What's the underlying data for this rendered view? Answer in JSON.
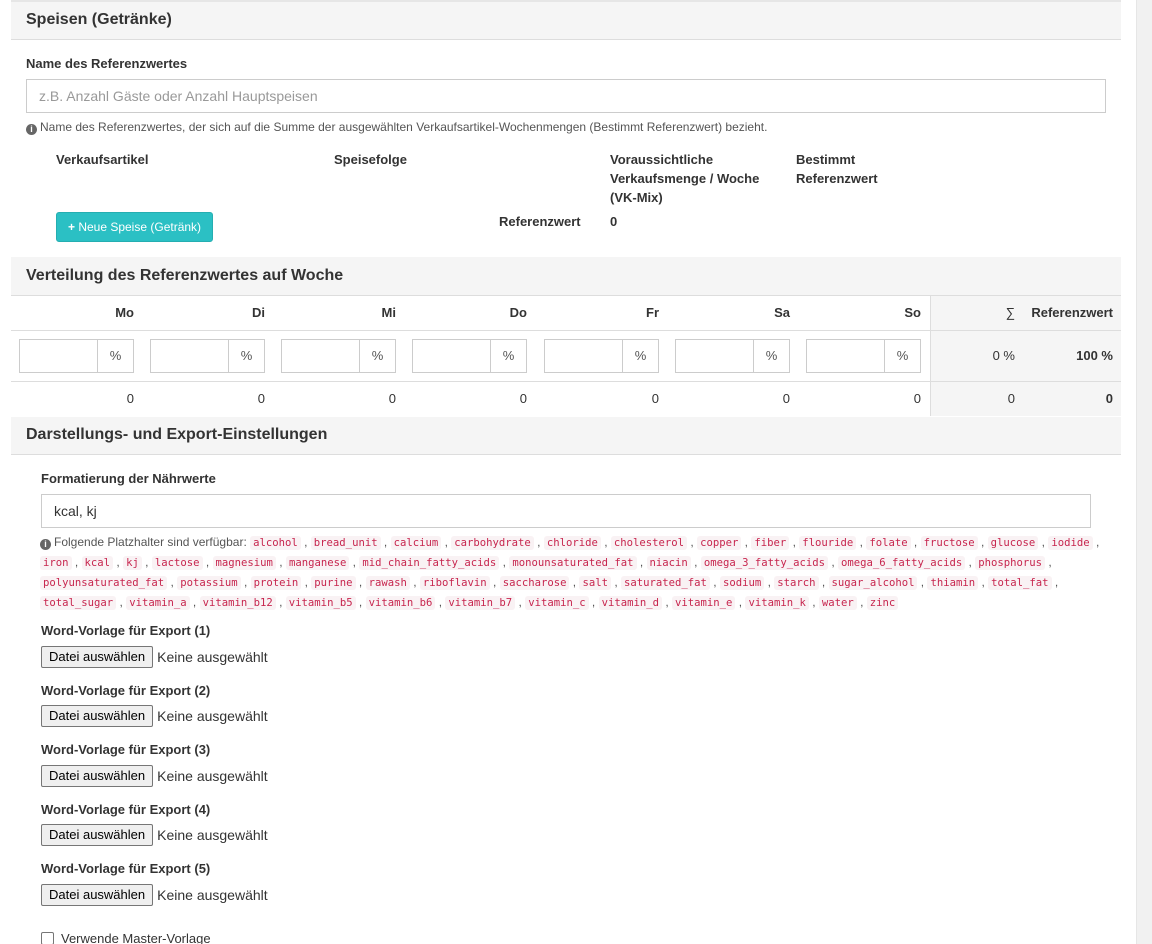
{
  "sections": {
    "speisen_title": "Speisen (Getränke)",
    "verteilung_title": "Verteilung des Referenzwertes auf Woche",
    "darstellung_title": "Darstellungs- und Export-Einstellungen"
  },
  "reference": {
    "name_label": "Name des Referenzwertes",
    "name_placeholder": "z.B. Anzahl Gäste oder Anzahl Hauptspeisen",
    "name_value": "",
    "help_text": "Name des Referenzwertes, der sich auf die Summe der ausgewählten Verkaufsartikel-Wochenmengen (Bestimmt Referenzwert) bezieht."
  },
  "items_table": {
    "col_verkaufsartikel": "Verkaufsartikel",
    "col_speisefolge": "Speisefolge",
    "col_menge_1": "Voraussichtliche",
    "col_menge_2": "Verkaufsmenge / Woche",
    "col_menge_3": "(VK-Mix)",
    "col_bestimmt_1": "Bestimmt",
    "col_bestimmt_2": "Referenzwert",
    "new_button": "Neue Speise (Getränk)",
    "referenzwert_label": "Referenzwert",
    "referenzwert_value": "0"
  },
  "week": {
    "days": [
      "Mo",
      "Di",
      "Mi",
      "Do",
      "Fr",
      "Sa",
      "So"
    ],
    "percent_unit": "%",
    "day_values": [
      "0",
      "0",
      "0",
      "0",
      "0",
      "0",
      "0"
    ],
    "sum_symbol": "∑",
    "ref_header": "Referenzwert",
    "sum_percent": "0 %",
    "ref_percent": "100 %",
    "sum_value": "0",
    "ref_value": "0"
  },
  "export": {
    "format_label": "Formatierung der Nährwerte",
    "format_value": "kcal, kj",
    "placeholder_intro": "Folgende Platzhalter sind verfügbar:",
    "placeholders": [
      "alcohol",
      "bread_unit",
      "calcium",
      "carbohydrate",
      "chloride",
      "cholesterol",
      "copper",
      "fiber",
      "flouride",
      "folate",
      "fructose",
      "glucose",
      "iodide",
      "iron",
      "kcal",
      "kj",
      "lactose",
      "magnesium",
      "manganese",
      "mid_chain_fatty_acids",
      "monounsaturated_fat",
      "niacin",
      "omega_3_fatty_acids",
      "omega_6_fatty_acids",
      "phosphorus",
      "polyunsaturated_fat",
      "potassium",
      "protein",
      "purine",
      "rawash",
      "riboflavin",
      "saccharose",
      "salt",
      "saturated_fat",
      "sodium",
      "starch",
      "sugar_alcohol",
      "thiamin",
      "total_fat",
      "total_sugar",
      "vitamin_a",
      "vitamin_b12",
      "vitamin_b5",
      "vitamin_b6",
      "vitamin_b7",
      "vitamin_c",
      "vitamin_d",
      "vitamin_e",
      "vitamin_k",
      "water",
      "zinc"
    ],
    "templates": [
      {
        "label": "Word-Vorlage für Export (1)",
        "button": "Datei auswählen",
        "status": "Keine ausgewählt"
      },
      {
        "label": "Word-Vorlage für Export (2)",
        "button": "Datei auswählen",
        "status": "Keine ausgewählt"
      },
      {
        "label": "Word-Vorlage für Export (3)",
        "button": "Datei auswählen",
        "status": "Keine ausgewählt"
      },
      {
        "label": "Word-Vorlage für Export (4)",
        "button": "Datei auswählen",
        "status": "Keine ausgewählt"
      },
      {
        "label": "Word-Vorlage für Export (5)",
        "button": "Datei auswählen",
        "status": "Keine ausgewählt"
      }
    ],
    "master_checkbox_label": "Verwende Master-Vorlage"
  },
  "icons": {
    "info": "info-circle-icon",
    "plus": "plus-icon"
  }
}
